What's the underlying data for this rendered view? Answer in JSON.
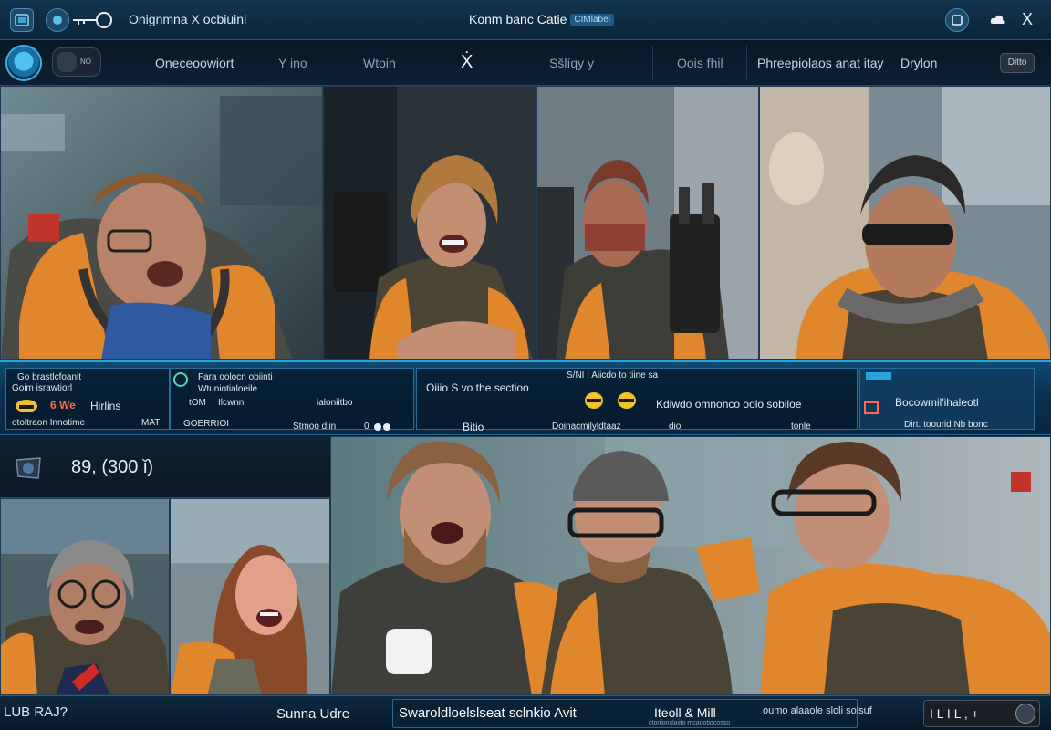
{
  "titlebar": {
    "app_title": "Onignmna  X ocbiuinl",
    "window_title": "Konm banc Catie",
    "window_pill": "CIMlabel",
    "close_glyph": "X"
  },
  "nav": {
    "toggle_label": "NO",
    "items": [
      "Oneceoowiort",
      "Y ino",
      "Wtoin",
      "Sšlíqy y",
      "Oois fhil",
      "Phreepiolaos anat itay",
      "Drylon"
    ],
    "x_glyph": "Ẋ",
    "badge": "Ditto"
  },
  "strip": {
    "card1": {
      "l1": "Go brastlcfoanit",
      "l2": "Goim israwtiorl",
      "hl": "6 We",
      "l3": "Hirlins",
      "l4": "otoltraon Innotime",
      "l5": "MAT"
    },
    "card2": {
      "l1": "Fara oolocn obiinti",
      "l2": "Wtuniotialoeile",
      "l3": "tOM",
      "l4": "Ilcwnn",
      "l5": "ialoniitbo",
      "l6": "GOERRIOI",
      "l7": "Stmoo  dlin",
      "l8": "0"
    },
    "card3": {
      "l1": "Oiiio S vo  the sectioo",
      "l2": "S/NI  I Aiicdo  to  tiine sa",
      "l3": "Kdiwdo  omnonco  oolo  sobiloe",
      "l4": "Bitio",
      "l5": "Doinacmilyldtaaz",
      "l6": "dio",
      "l7": "tonle"
    },
    "card4": {
      "l1": "Bocowmil'ihaleotl",
      "l2": "Dirt.  toourid  Nb bonc"
    }
  },
  "counter": {
    "text": "89,  (300 ǐ)"
  },
  "bottombar": {
    "left": "LUB RAJ?",
    "mid": "Sunna Udre",
    "ticker1": "Swaroldloelslseat sclnkio Avit",
    "ticker2": "Iteoll & Mill",
    "ticker3": "oumo alaaole   sloli solsuf",
    "ticker4": "ctorilonslaiito  mcaootiocosso",
    "right": "I L I L ,  +"
  }
}
